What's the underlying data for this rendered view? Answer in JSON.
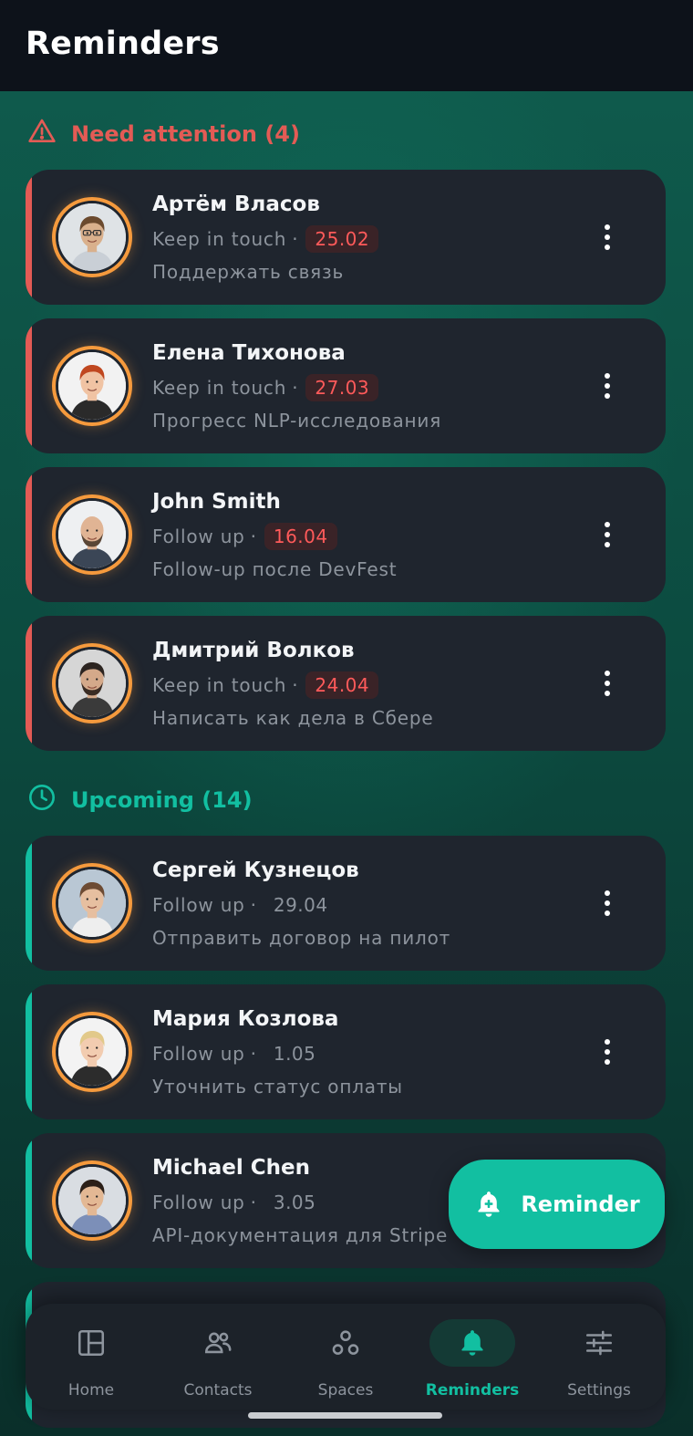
{
  "header": {
    "title": "Reminders"
  },
  "colors": {
    "overdue": "#e35b55",
    "upcoming": "#12bfa1",
    "avatar_ring": "#f59a3d"
  },
  "sections": {
    "attention": {
      "title": "Need attention (4)",
      "icon": "warning-triangle-icon",
      "items": [
        {
          "name": "Артём Власов",
          "type": "Keep in touch",
          "date": "25.02",
          "note": "Поддержать связь",
          "avatar": "man-glasses"
        },
        {
          "name": "Елена Тихонова",
          "type": "Keep in touch",
          "date": "27.03",
          "note": "Прогресс NLP-исследования",
          "avatar": "woman-redhair"
        },
        {
          "name": "John Smith",
          "type": "Follow up",
          "date": "16.04",
          "note": "Follow-up после DevFest",
          "avatar": "man-bald"
        },
        {
          "name": "Дмитрий Волков",
          "type": "Keep in touch",
          "date": "24.04",
          "note": "Написать как дела в Сбере",
          "avatar": "man-dark"
        }
      ]
    },
    "upcoming": {
      "title": "Upcoming (14)",
      "icon": "clock-icon",
      "items": [
        {
          "name": "Сергей Кузнецов",
          "type": "Follow up",
          "date": "29.04",
          "note": "Отправить договор на пилот",
          "avatar": "man-young"
        },
        {
          "name": "Мария Козлова",
          "type": "Follow up",
          "date": "1.05",
          "note": "Уточнить статус оплаты",
          "avatar": "woman-blonde"
        },
        {
          "name": "Michael Chen",
          "type": "Follow up",
          "date": "3.05",
          "note": "API-документация для Stripe",
          "avatar": "man-smile"
        }
      ]
    }
  },
  "fab": {
    "label": "Reminder",
    "icon": "bell-plus-icon"
  },
  "nav": {
    "items": [
      {
        "label": "Home",
        "icon": "dashboard-icon",
        "active": false
      },
      {
        "label": "Contacts",
        "icon": "people-icon",
        "active": false
      },
      {
        "label": "Spaces",
        "icon": "spaces-icon",
        "active": false
      },
      {
        "label": "Reminders",
        "icon": "bell-icon",
        "active": true
      },
      {
        "label": "Settings",
        "icon": "sliders-icon",
        "active": false
      }
    ]
  }
}
